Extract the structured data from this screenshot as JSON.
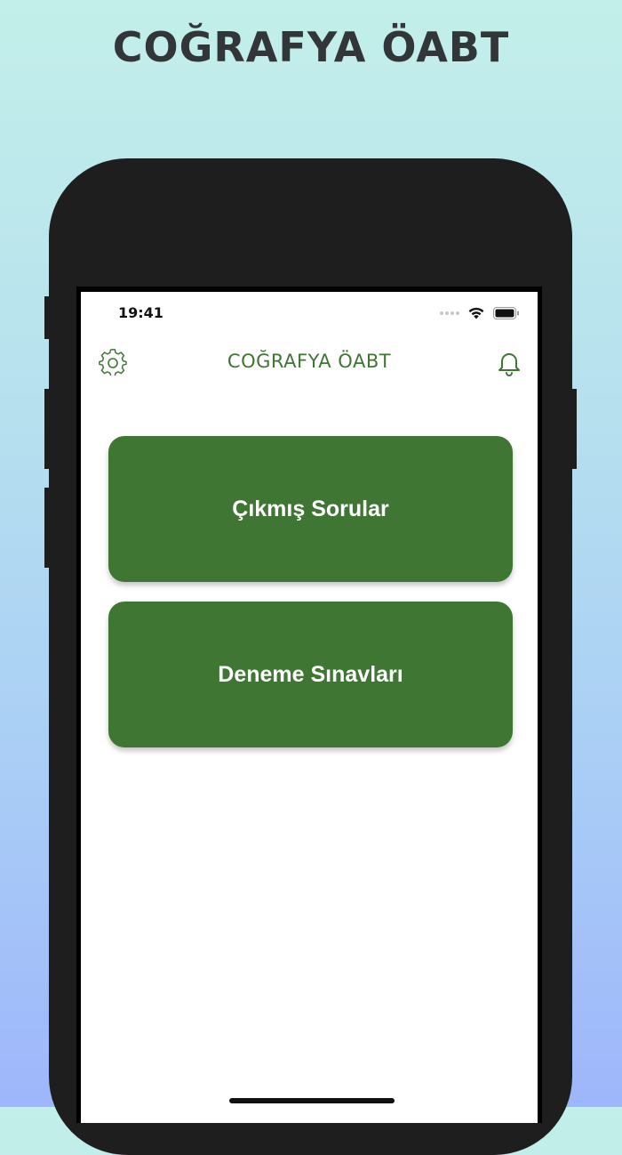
{
  "promo": {
    "title": "COĞRAFYA ÖABT"
  },
  "status_bar": {
    "time": "19:41"
  },
  "header": {
    "title": "COĞRAFYA ÖABT",
    "left_icon": "gear-icon",
    "right_icon": "bell-icon"
  },
  "menu": {
    "items": [
      {
        "label": "Çıkmış Sorular"
      },
      {
        "label": "Deneme Sınavları"
      }
    ]
  },
  "colors": {
    "accent": "#3f7634",
    "card_text": "#ffffff",
    "promo_title": "#333638"
  }
}
